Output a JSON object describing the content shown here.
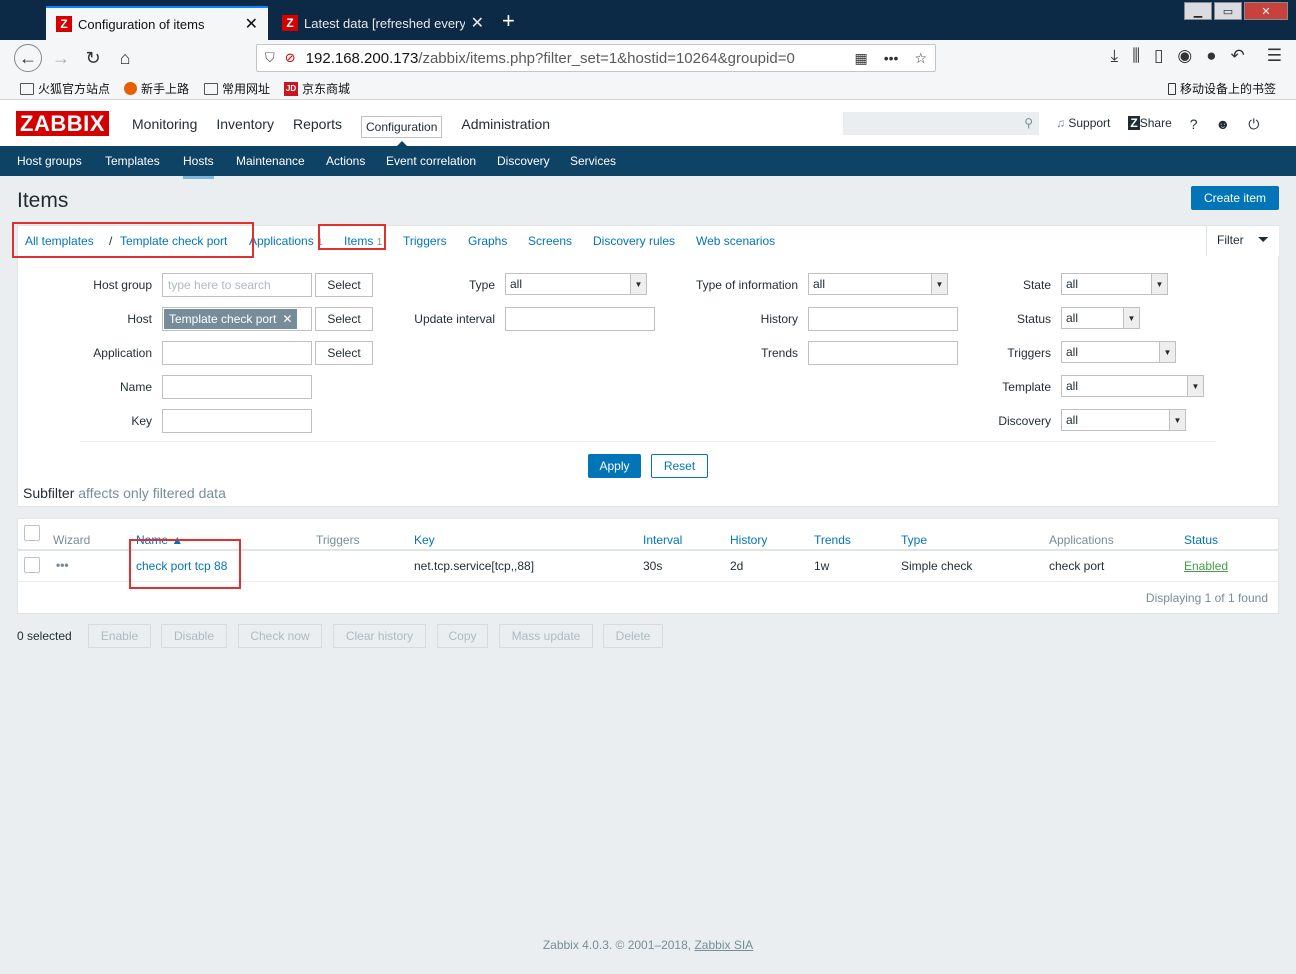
{
  "browser": {
    "tabs": [
      {
        "label": "Configuration of items",
        "active": true
      },
      {
        "label": "Latest data [refreshed every",
        "active": false
      }
    ],
    "url_host": "192.168.200.173",
    "url_path": "/zabbix/items.php?filter_set=1&hostid=10264&groupid=0",
    "bookmarks": [
      "火狐官方站点",
      "新手上路",
      "常用网址",
      "京东商城"
    ],
    "mobile_bookmarks": "移动设备上的书签"
  },
  "header": {
    "logo": "ZABBIX",
    "menu": [
      "Monitoring",
      "Inventory",
      "Reports",
      "Configuration",
      "Administration"
    ],
    "support": "Support",
    "share": "Share",
    "help": "?"
  },
  "submenu": [
    "Host groups",
    "Templates",
    "Hosts",
    "Maintenance",
    "Actions",
    "Event correlation",
    "Discovery",
    "Services"
  ],
  "page": {
    "title": "Items",
    "create_button": "Create item"
  },
  "breadcrumb": {
    "all_templates": "All templates",
    "slash": "/",
    "template": "Template check port",
    "applications": "Applications",
    "applications_count": "1",
    "items": "Items",
    "items_count": "1",
    "triggers": "Triggers",
    "graphs": "Graphs",
    "screens": "Screens",
    "discovery_rules": "Discovery rules",
    "web_scenarios": "Web scenarios"
  },
  "filter": {
    "tab_label": "Filter",
    "host_group_label": "Host group",
    "host_group_placeholder": "type here to search",
    "select_label": "Select",
    "host_label": "Host",
    "host_value": "Template check port",
    "application_label": "Application",
    "name_label": "Name",
    "key_label": "Key",
    "type_label": "Type",
    "type_value": "all",
    "update_interval_label": "Update interval",
    "type_of_info_label": "Type of information",
    "type_of_info_value": "all",
    "history_label": "History",
    "trends_label": "Trends",
    "state_label": "State",
    "state_value": "all",
    "status_label": "Status",
    "status_value": "all",
    "triggers_label": "Triggers",
    "triggers_value": "all",
    "template_label": "Template",
    "template_value": "all",
    "discovery_label": "Discovery",
    "discovery_value": "all",
    "apply": "Apply",
    "reset": "Reset",
    "subfilter": "Subfilter",
    "subfilter_note": "affects only filtered data"
  },
  "table": {
    "headers": {
      "wizard": "Wizard",
      "name": "Name ▲",
      "triggers": "Triggers",
      "key": "Key",
      "interval": "Interval",
      "history": "History",
      "trends": "Trends",
      "type": "Type",
      "applications": "Applications",
      "status": "Status"
    },
    "rows": [
      {
        "wizard": "•••",
        "name": "check port tcp 88",
        "key": "net.tcp.service[tcp,,88]",
        "interval": "30s",
        "history": "2d",
        "trends": "1w",
        "type": "Simple check",
        "applications": "check port",
        "status": "Enabled"
      }
    ],
    "footer": "Displaying 1 of 1 found"
  },
  "mass_actions": {
    "selected": "0 selected",
    "buttons": [
      "Enable",
      "Disable",
      "Check now",
      "Clear history",
      "Copy",
      "Mass update",
      "Delete"
    ]
  },
  "footer": {
    "text": "Zabbix 4.0.3. © 2001–2018,",
    "link": "Zabbix SIA"
  },
  "colors": {
    "brand_red": "#d40000",
    "nav_blue": "#0e4365",
    "link_blue": "#0275b8",
    "enabled_green": "#429e47",
    "highlight_red": "#e03030"
  }
}
